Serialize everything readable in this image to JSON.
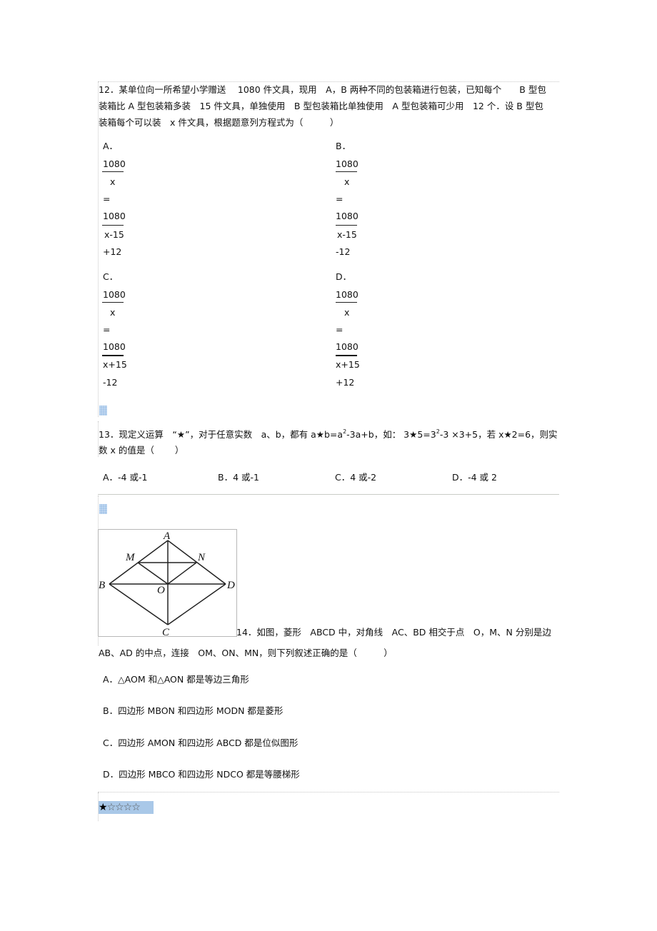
{
  "q12": {
    "lines": [
      "12．某单位向一所希望小学赠送　 1080  件文具，现用　A，B 两种不同的包装箱进行包装，已知每个　　B 型包",
      "装箱比  A 型包装箱多装　15 件文具，单独使用　B 型包装箱比单独使用　A 型包装箱可少用　12 个．设  B 型包",
      "装箱每个可以装　x 件文具，根据题意列方程式为（　　　）"
    ],
    "options": [
      {
        "label": "A．",
        "num1": "1080",
        "den1": "x",
        "eq": "=",
        "num2": "1080",
        "den2": "x-15",
        "tail": "+12"
      },
      {
        "label": "B．",
        "num1": "1080",
        "den1": "x",
        "eq": "=",
        "num2": "1080",
        "den2": "x-15",
        "tail": "-12"
      },
      {
        "label": "C．",
        "num1": "1080",
        "den1": "x",
        "eq": "=",
        "num2": "1080",
        "den2": "x+15",
        "tail": "-12"
      },
      {
        "label": "D．",
        "num1": "1080",
        "den1": "x",
        "eq": "=",
        "num2": "1080",
        "den2": "x+15",
        "tail": "+12"
      }
    ]
  },
  "q13": {
    "line1_a": "13．现定义运算　“★”，对于任意实数　a、b，都有  a★b=a",
    "line1_sup1": "2",
    "line1_b": "-3a+b，如：  3★5=3",
    "line1_sup2": "2",
    "line1_c": "-3 ×3+5，若  x★2=6，则实",
    "line2": "数 x 的值是（　　 ）",
    "options": [
      "A．-4 或-1",
      "B．4 或-1",
      "C．4 或-2",
      "D．-4 或 2"
    ]
  },
  "q14": {
    "figure_labels": {
      "A": "A",
      "B": "B",
      "C": "C",
      "D": "D",
      "M": "M",
      "N": "N",
      "O": "O"
    },
    "line1": "14．如图，菱形　ABCD 中，对角线　AC、BD 相交于点　O，M、N 分别是边",
    "line2": "AB、AD 的中点，连接　OM、ON、MN，则下列叙述正确的是（　　　）",
    "options": [
      "A．△AOM 和△AON 都是等边三角形",
      "B．四边形  MBON  和四边形  MODN  都是菱形",
      "C．四边形  AMON  和四边形  ABCD  都是位似图形",
      "D．四边形  MBCO  和四边形  NDCO  都是等腰梯形"
    ]
  },
  "difficulty": {
    "filled": "★",
    "empty": "☆☆☆☆",
    "rating": 1,
    "max": 5
  }
}
